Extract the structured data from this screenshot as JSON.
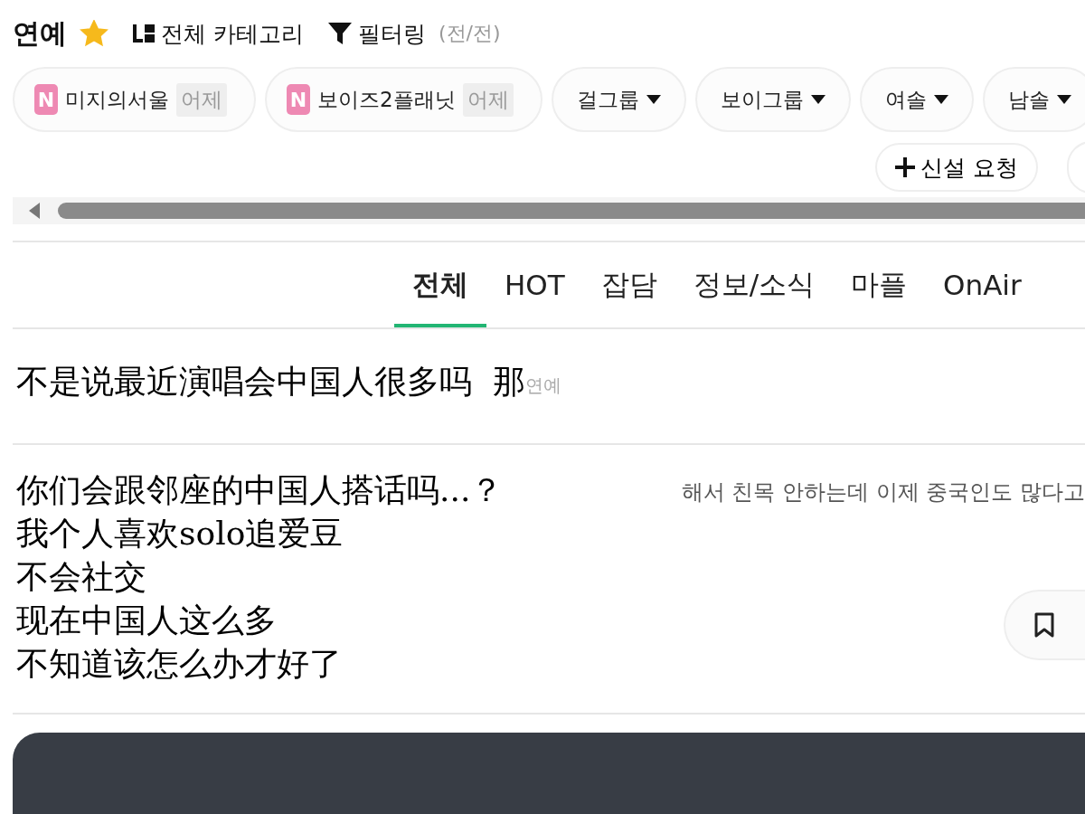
{
  "header": {
    "title": "연예",
    "starred": true,
    "category_button": "전체 카테고리",
    "filter_button": "필터링",
    "filter_range": "(전/전)"
  },
  "boards": [
    {
      "badge": "N",
      "name": "미지의서울",
      "time": "어제"
    },
    {
      "badge": "N",
      "name": "보이즈2플래닛",
      "time": "어제"
    }
  ],
  "filters": [
    "걸그룹",
    "보이그룹",
    "여솔",
    "남솔"
  ],
  "request_button": "신설 요청",
  "tabs": [
    {
      "label": "전체",
      "selected": true
    },
    {
      "label": "HOT",
      "selected": false
    },
    {
      "label": "잡담",
      "selected": false
    },
    {
      "label": "정보/소식",
      "selected": false
    },
    {
      "label": "마플",
      "selected": false
    },
    {
      "label": "OnAir",
      "selected": false
    }
  ],
  "posts": [
    {
      "kind": "title",
      "text": "不是说最近演唱会中国人很多吗  那",
      "tag": "연예"
    },
    {
      "kind": "preview",
      "lines": [
        "你们会跟邻座的中国人搭话吗...？",
        "我个人喜欢solo追爱豆",
        "不会社交",
        "现在中国人这么多",
        "不知道该怎么办才好了"
      ],
      "snippet": "해서 친목 안하는데 이제 중국인도 많다고"
    }
  ]
}
